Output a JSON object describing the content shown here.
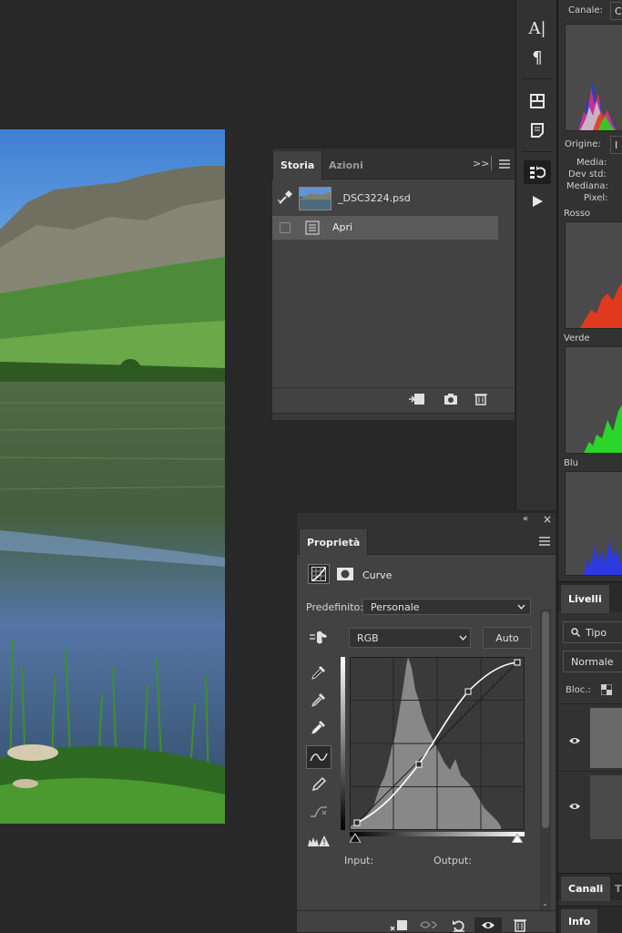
{
  "colors": {
    "app_bg": "#282828",
    "panel_bg": "#424242",
    "panel_dark": "#323232",
    "red": "#e03a1e",
    "green": "#2ad42a",
    "blue": "#2c3ae0"
  },
  "istogramma": {
    "canale_label": "Canale:",
    "canale_value": "C",
    "origine_label": "Origine:",
    "origine_value": "I",
    "stats": [
      "Media:",
      "Dev std:",
      "Mediana:",
      "Pixel:"
    ],
    "channels": [
      "Rosso",
      "Verde",
      "Blu"
    ]
  },
  "storia": {
    "tabs": [
      "Storia",
      "Azioni"
    ],
    "menu_glyph": ">>",
    "snapshot_name": "_DSC3224.psd",
    "steps": [
      "Apri"
    ]
  },
  "proprieta": {
    "title": "Proprietà",
    "type_label": "Curve",
    "predefinito_label": "Predefinito:",
    "predefinito_value": "Personale",
    "channel_value": "RGB",
    "auto_label": "Auto",
    "input_label": "Input:",
    "output_label": "Output:"
  },
  "livelli": {
    "tab": "Livelli",
    "filter_label": "Tipo",
    "blend_mode": "Normale",
    "lock_label": "Bloc.:"
  },
  "bottom_tabs": {
    "canali": "Canali",
    "second": "T",
    "info": "Info"
  },
  "toolstrip": [
    "character-icon",
    "paragraph-icon",
    "glyphs-icon",
    "notes-icon",
    "history-icon",
    "actions-play-icon"
  ]
}
